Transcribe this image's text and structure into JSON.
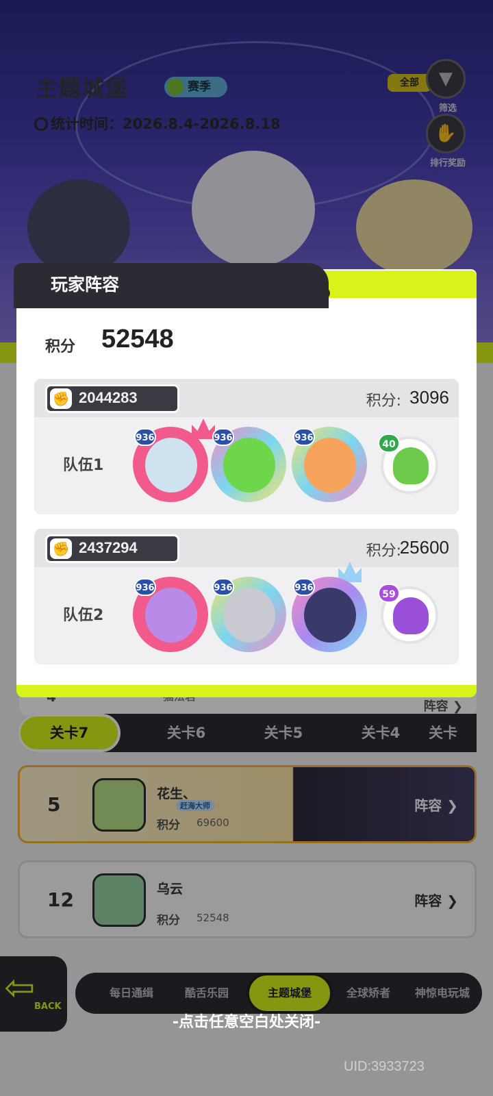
{
  "header": {
    "title": "主题城堡",
    "season_label": "赛季",
    "stat_time": "统计时间：2026.8.4-2026.8.18",
    "filter_all": "全部",
    "filter_label": "筛选",
    "reward_label": "排行奖励"
  },
  "behind_card": {
    "rank": "4",
    "name": "猫法君",
    "lineup": "阵容"
  },
  "level_tabs": [
    "关卡7",
    "关卡6",
    "关卡5",
    "关卡4",
    "关卡"
  ],
  "rankings": [
    {
      "rank": "5",
      "name": "花生、",
      "badge": "赶海大师",
      "score_label": "积分",
      "score": "69600",
      "lineup": "阵容"
    },
    {
      "rank": "12",
      "name": "乌云",
      "score_label": "积分",
      "score": "52548",
      "lineup": "阵容"
    }
  ],
  "bottom_nav": [
    "每日通缉",
    "酷舌乐园",
    "主题城堡",
    "全球矫者",
    "神惊电玩城"
  ],
  "back_label": "BACK",
  "close_hint": "-点击任意空白处关闭-",
  "uid": "UID:3933723",
  "modal": {
    "title": "玩家阵容",
    "score_label": "积分",
    "score_value": "52548",
    "teams": [
      {
        "player_id": "2044283",
        "score_label": "积分:",
        "score": "3096",
        "name": "队伍1",
        "heroes": [
          {
            "level": "936",
            "ring": "#f25a8c",
            "face": "#cfe2f0"
          },
          {
            "level": "936",
            "ring": "#4fc3e8",
            "face": "#6ed64a"
          },
          {
            "level": "936",
            "ring": "#f2c94c",
            "face": "#f7a35c"
          }
        ],
        "pet": {
          "level": "40",
          "color": "#6ccb4a"
        }
      },
      {
        "player_id": "2437294",
        "score_label": "积分:",
        "score": "25600",
        "name": "队伍2",
        "heroes": [
          {
            "level": "936",
            "ring": "#f25a8c",
            "face": "#b98ae8"
          },
          {
            "level": "936",
            "ring": "#4fc3e8",
            "face": "#c9c9d2"
          },
          {
            "level": "936",
            "ring": "#a98af0",
            "face": "#3a3a6a"
          }
        ],
        "pet": {
          "level": "59",
          "color": "#9a4fd8"
        }
      }
    ]
  },
  "colors": {
    "accent": "#d8f21a",
    "dark": "#2b2b33"
  }
}
